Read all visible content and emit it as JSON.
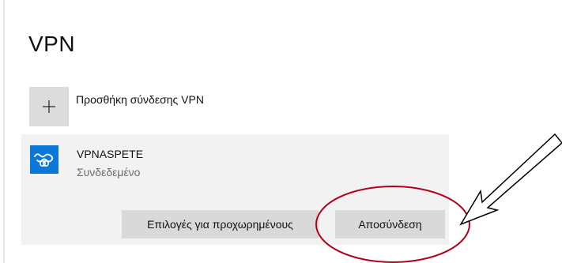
{
  "page": {
    "title": "VPN"
  },
  "add_connection": {
    "label": "Προσθήκη σύνδεσης VPN",
    "icon": "plus-icon"
  },
  "vpn_item": {
    "name": "VPNASPETE",
    "status": "Συνδεδεμένο",
    "icon": "vpn-link-icon",
    "icon_color": "#0b78d7"
  },
  "buttons": {
    "advanced": "Επιλογές για προχωρημένους",
    "disconnect": "Αποσύνδεση"
  },
  "annotations": {
    "highlight": "ellipse",
    "highlight_color": "#b3001b",
    "pointer": "arrow",
    "pointer_color": "#000000"
  }
}
